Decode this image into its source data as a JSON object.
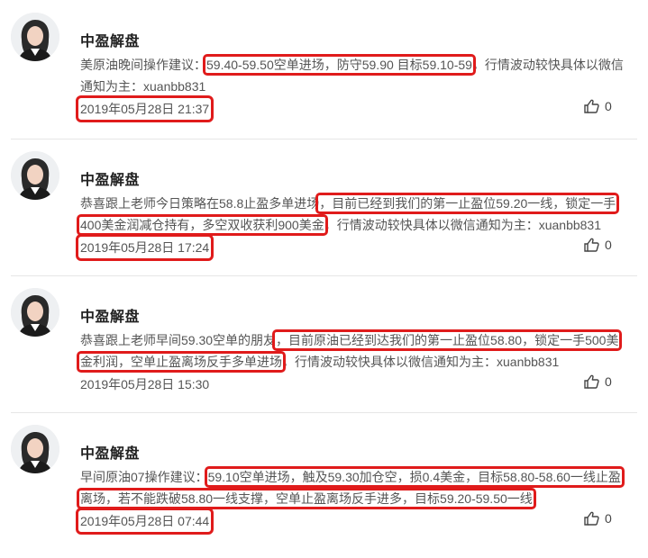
{
  "posts": [
    {
      "author": "中盈解盘",
      "lines": [
        [
          {
            "text": "美原油晚间操作建议：",
            "boxed": false
          },
          {
            "text": "59.40-59.50空单进场，防守59.90 目标59.10-59",
            "boxed": true
          },
          {
            "text": "，行情波动较快具体以微信",
            "boxed": false
          }
        ],
        [
          {
            "text": "通知为主：xuanbb831",
            "boxed": false
          }
        ]
      ],
      "date": "2019年05月28日 21:37",
      "date_boxed": true,
      "likes": "0"
    },
    {
      "author": "中盈解盘",
      "lines": [
        [
          {
            "text": "恭喜跟上老师今日策略在58.8止盈多单进场",
            "boxed": false
          },
          {
            "text": "，目前已经到我们的第一止盈位59.20一线，锁定一手",
            "boxed": true
          }
        ],
        [
          {
            "text": "400美金润减仓持有，多空双收获利900美金",
            "boxed": true
          },
          {
            "text": "，行情波动较快具体以微信通知为主：xuanbb831",
            "boxed": false
          }
        ]
      ],
      "date": "2019年05月28日 17:24",
      "date_boxed": true,
      "likes": "0"
    },
    {
      "author": "中盈解盘",
      "lines": [
        [
          {
            "text": "恭喜跟上老师早间59.30空单的朋友",
            "boxed": false
          },
          {
            "text": "，目前原油已经到达我们的第一止盈位58.80，锁定一手500美",
            "boxed": true
          }
        ],
        [
          {
            "text": "金利润，空单止盈离场反手多单进场",
            "boxed": true
          },
          {
            "text": "，行情波动较快具体以微信通知为主：xuanbb831",
            "boxed": false
          }
        ]
      ],
      "date": "2019年05月28日 15:30",
      "date_boxed": false,
      "likes": "0"
    },
    {
      "author": "中盈解盘",
      "lines": [
        [
          {
            "text": "早间原油07操作建议：",
            "boxed": false
          },
          {
            "text": "59.10空单进场，触及59.30加仓空，损0.4美金，目标58.80-58.60一线止盈",
            "boxed": true
          }
        ],
        [
          {
            "text": "离场，若不能跌破58.80一线支撑，空单止盈离场反手进多，目标59.20-59.50一线",
            "boxed": true
          }
        ]
      ],
      "date": "2019年05月28日 07:44",
      "date_boxed": true,
      "likes": "0"
    }
  ],
  "icons": {
    "avatar": "woman-portrait-avatar",
    "like": "thumbs-up-icon"
  },
  "colors": {
    "highlight_box": "#e01b1b",
    "divider": "#e6e6e6"
  }
}
